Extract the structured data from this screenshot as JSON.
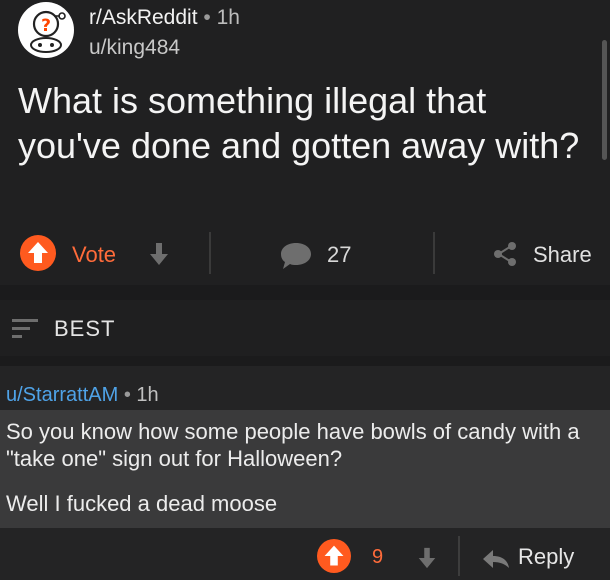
{
  "post": {
    "subreddit": "r/AskReddit",
    "separator": "•",
    "age": "1h",
    "author": "u/king484",
    "title": "What is something illegal that you've done and gotten away with?",
    "vote_label": "Vote",
    "comment_count": "27",
    "share_label": "Share",
    "avatar_icon": "askreddit-snoo-icon"
  },
  "sort": {
    "label": "BEST",
    "icon": "sort-filter-icon"
  },
  "comment": {
    "author": "u/StarrattAM",
    "separator": "•",
    "age": "1h",
    "paragraph_1": "So you know how some people have bowls of candy with a \"take one\" sign out for Halloween?",
    "paragraph_2": "Well I fucked a dead moose",
    "score": "9",
    "reply_label": "Reply"
  },
  "colors": {
    "accent_upvote": "#ff5a1f",
    "username": "#4fa3e8",
    "background": "#1b1b1c"
  }
}
